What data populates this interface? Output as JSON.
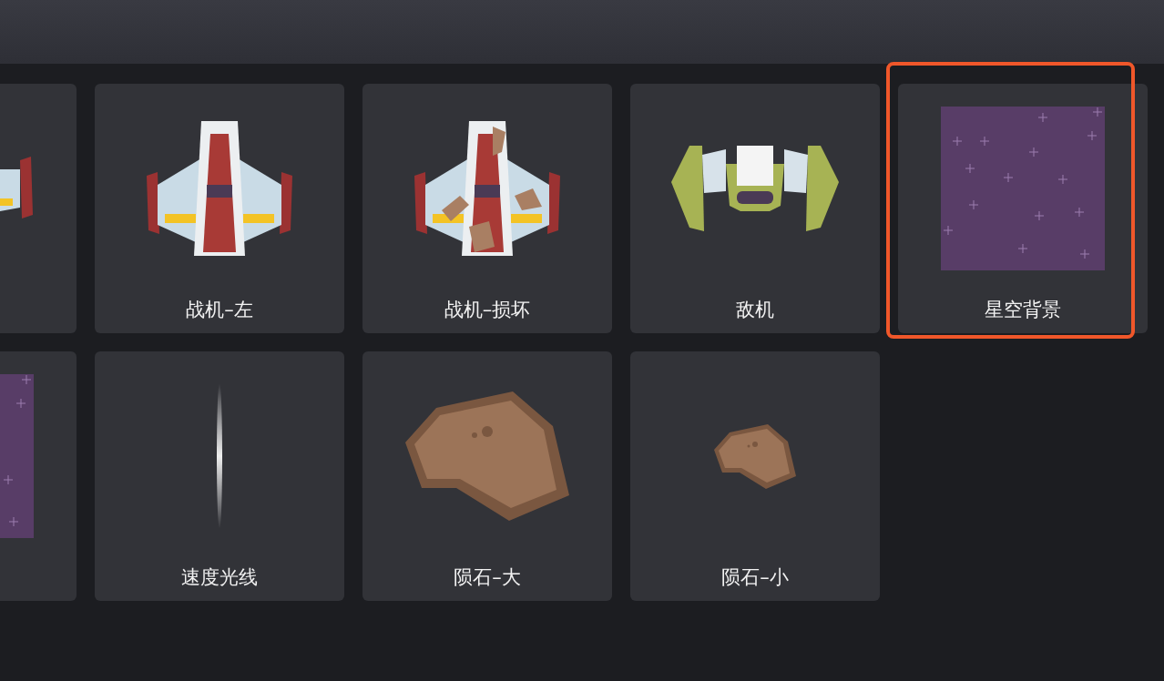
{
  "rows": [
    {
      "cards": [
        {
          "kind": "ship-edge",
          "selected": false
        },
        {
          "kind": "ship",
          "label": "战机–左",
          "selected": false
        },
        {
          "kind": "ship-damaged",
          "label": "战机–损坏",
          "selected": false
        },
        {
          "kind": "enemy",
          "label": "敌机",
          "selected": false
        },
        {
          "kind": "starfield",
          "label": "星空背景",
          "selected": true
        }
      ]
    },
    {
      "cards": [
        {
          "kind": "starfield",
          "selected": false
        },
        {
          "kind": "speed-line",
          "label": "速度光线",
          "selected": false
        },
        {
          "kind": "meteor-large",
          "label": "陨石–大",
          "selected": false
        },
        {
          "kind": "meteor-small",
          "label": "陨石–小",
          "selected": false
        }
      ]
    }
  ]
}
